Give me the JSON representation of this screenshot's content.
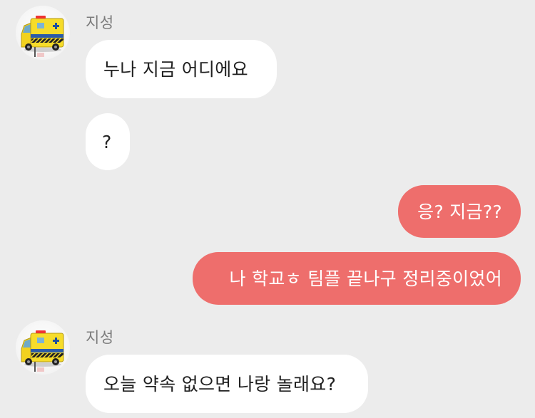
{
  "colors": {
    "background": "#ececec",
    "incoming_bubble": "#ffffff",
    "outgoing_bubble": "#ee6e6c",
    "sender_name": "#7c7c7c"
  },
  "messages": [
    {
      "direction": "incoming",
      "sender": "지성",
      "avatar_icon": "ambulance-toy-icon",
      "texts": [
        "누나 지금 어디에요",
        "?"
      ]
    },
    {
      "direction": "outgoing",
      "texts": [
        "응? 지금??",
        "나 학교ㅎ 팀플 끝나구 정리중이었어"
      ]
    },
    {
      "direction": "incoming",
      "sender": "지성",
      "avatar_icon": "ambulance-toy-icon",
      "texts": [
        "오늘 약속 없으면 나랑 놀래요?"
      ]
    }
  ]
}
